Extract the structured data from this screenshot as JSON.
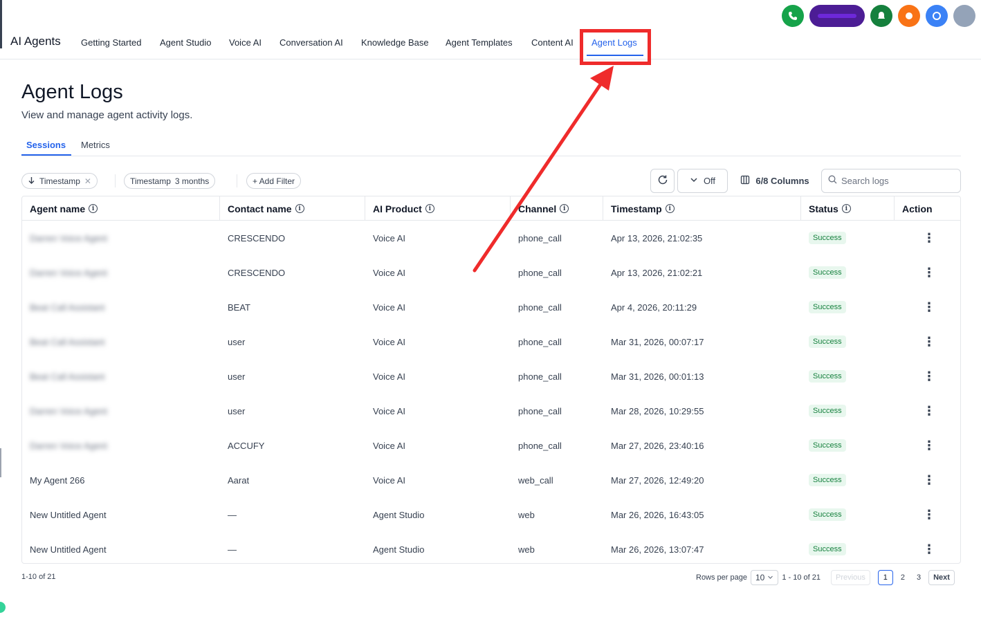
{
  "nav": {
    "brand": "AI Agents",
    "items": [
      {
        "label": "Getting Started"
      },
      {
        "label": "Agent Studio"
      },
      {
        "label": "Voice AI"
      },
      {
        "label": "Conversation AI"
      },
      {
        "label": "Knowledge Base"
      },
      {
        "label": "Agent Templates"
      },
      {
        "label": "Content AI"
      },
      {
        "label": "Agent Logs"
      }
    ]
  },
  "header": {
    "title": "Agent Logs",
    "subtitle": "View and manage agent activity logs."
  },
  "tabs": [
    {
      "label": "Sessions",
      "active": true
    },
    {
      "label": "Metrics",
      "active": false
    }
  ],
  "filters": {
    "sort_chip": "Timestamp",
    "range_chip_label": "Timestamp",
    "range_chip_value": "3 months",
    "add_filter": "+ Add Filter",
    "auto_refresh": "Off",
    "columns": "6/8 Columns",
    "search_placeholder": "Search logs"
  },
  "table": {
    "columns": [
      "Agent name",
      "Contact name",
      "AI Product",
      "Channel",
      "Timestamp",
      "Status",
      "Action"
    ],
    "rows": [
      {
        "agent": "Darren Voice Agent",
        "agent_blurred": true,
        "contact": "CRESCENDO",
        "product": "Voice AI",
        "channel": "phone_call",
        "timestamp": "Apr 13, 2026, 21:02:35",
        "status": "Success"
      },
      {
        "agent": "Darren Voice Agent",
        "agent_blurred": true,
        "contact": "CRESCENDO",
        "product": "Voice AI",
        "channel": "phone_call",
        "timestamp": "Apr 13, 2026, 21:02:21",
        "status": "Success"
      },
      {
        "agent": "Beat Call Assistant",
        "agent_blurred": true,
        "contact": "BEAT",
        "product": "Voice AI",
        "channel": "phone_call",
        "timestamp": "Apr 4, 2026, 20:11:29",
        "status": "Success"
      },
      {
        "agent": "Beat Call Assistant",
        "agent_blurred": true,
        "contact": "user",
        "product": "Voice AI",
        "channel": "phone_call",
        "timestamp": "Mar 31, 2026, 00:07:17",
        "status": "Success"
      },
      {
        "agent": "Beat Call Assistant",
        "agent_blurred": true,
        "contact": "user",
        "product": "Voice AI",
        "channel": "phone_call",
        "timestamp": "Mar 31, 2026, 00:01:13",
        "status": "Success"
      },
      {
        "agent": "Darren Voice Agent",
        "agent_blurred": true,
        "contact": "user",
        "product": "Voice AI",
        "channel": "phone_call",
        "timestamp": "Mar 28, 2026, 10:29:55",
        "status": "Success"
      },
      {
        "agent": "Darren Voice Agent",
        "agent_blurred": true,
        "contact": "ACCUFY",
        "product": "Voice AI",
        "channel": "phone_call",
        "timestamp": "Mar 27, 2026, 23:40:16",
        "status": "Success"
      },
      {
        "agent": "My Agent 266",
        "agent_blurred": false,
        "contact": "Aarat",
        "product": "Voice AI",
        "channel": "web_call",
        "timestamp": "Mar 27, 2026, 12:49:20",
        "status": "Success"
      },
      {
        "agent": "New Untitled Agent",
        "agent_blurred": false,
        "contact": "—",
        "product": "Agent Studio",
        "channel": "web",
        "timestamp": "Mar 26, 2026, 16:43:05",
        "status": "Success"
      },
      {
        "agent": "New Untitled Agent",
        "agent_blurred": false,
        "contact": "—",
        "product": "Agent Studio",
        "channel": "web",
        "timestamp": "Mar 26, 2026, 13:07:47",
        "status": "Success"
      }
    ]
  },
  "footer": {
    "count": "1-10 of 21",
    "rows_per_page_label": "Rows per page",
    "rows_per_page_value": "10",
    "range": "1 - 10 of 21",
    "previous": "Previous",
    "pages": [
      "1",
      "2",
      "3"
    ],
    "current_page": "1",
    "next": "Next"
  },
  "colors": {
    "accent": "#2563eb",
    "annotation": "#ef2b2b",
    "success_bg": "#e8f7ee",
    "success_text": "#15803d"
  }
}
